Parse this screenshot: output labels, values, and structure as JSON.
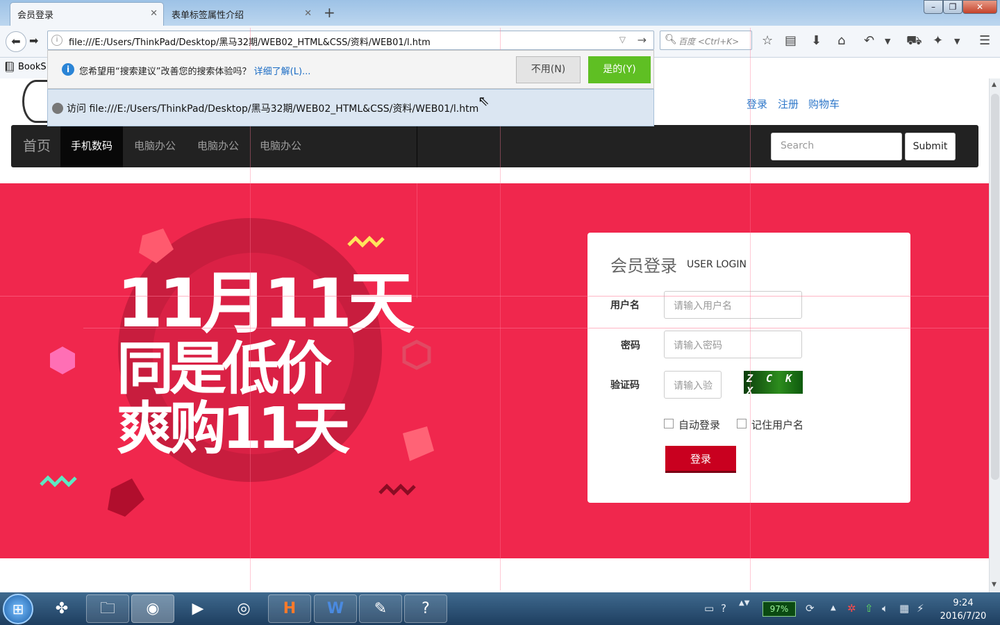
{
  "browser": {
    "tabs": [
      {
        "label": "会员登录",
        "active": true
      },
      {
        "label": "表单标签属性介绍",
        "active": false
      }
    ],
    "new_tab": "+",
    "window_controls": {
      "minimize": "–",
      "restore": "❐",
      "close": "✕"
    },
    "url": "file:///E:/Users/ThinkPad/Desktop/黑马32期/WEB02_HTML&CSS/资料/WEB01/l.htm",
    "search_placeholder": "百度 <Ctrl+K>",
    "bookmarks_label": "BookS"
  },
  "suggestion_bar": {
    "message": "您希望用“搜索建议”改善您的搜索体验吗？",
    "learn_more": "详细了解(L)...",
    "no_button": "不用(N)",
    "yes_button": "是的(Y)"
  },
  "autocomplete": {
    "visit_text": "访问 file:///E:/Users/ThinkPad/Desktop/黑马32期/WEB02_HTML&CSS/资料/WEB01/l.htm"
  },
  "site": {
    "top_links": [
      "登录",
      "注册",
      "购物车"
    ],
    "nav": {
      "brand": "首页",
      "items": [
        {
          "label": "手机数码",
          "active": true
        },
        {
          "label": "电脑办公",
          "active": false
        },
        {
          "label": "电脑办公",
          "active": false
        },
        {
          "label": "电脑办公",
          "active": false
        }
      ],
      "search_placeholder": "Search",
      "submit_label": "Submit"
    },
    "banner": {
      "line1": "11月11天",
      "line2": "同是低价",
      "line3": "爽购11天",
      "background_color": "#f0274d"
    },
    "login": {
      "title_cn": "会员登录",
      "title_en": "USER LOGIN",
      "username_label": "用户名",
      "username_placeholder": "请输入用户名",
      "password_label": "密码",
      "password_placeholder": "请输入密码",
      "captcha_label": "验证码",
      "captcha_placeholder": "请输入验",
      "captcha_text": "Z C K X",
      "auto_login_label": "自动登录",
      "remember_label": "记住用户名",
      "submit_label": "登录",
      "button_color": "#c9001f"
    }
  },
  "taskbar": {
    "battery": "97%",
    "time": "9:24",
    "date": "2016/7/20",
    "apps": [
      "start-orb",
      "pinwheel-icon",
      "file-explorer-icon",
      "firefox-icon",
      "media-player-icon",
      "chrome-icon",
      "hbuilder-icon",
      "word-icon",
      "notepad-icon",
      "help-icon"
    ]
  }
}
